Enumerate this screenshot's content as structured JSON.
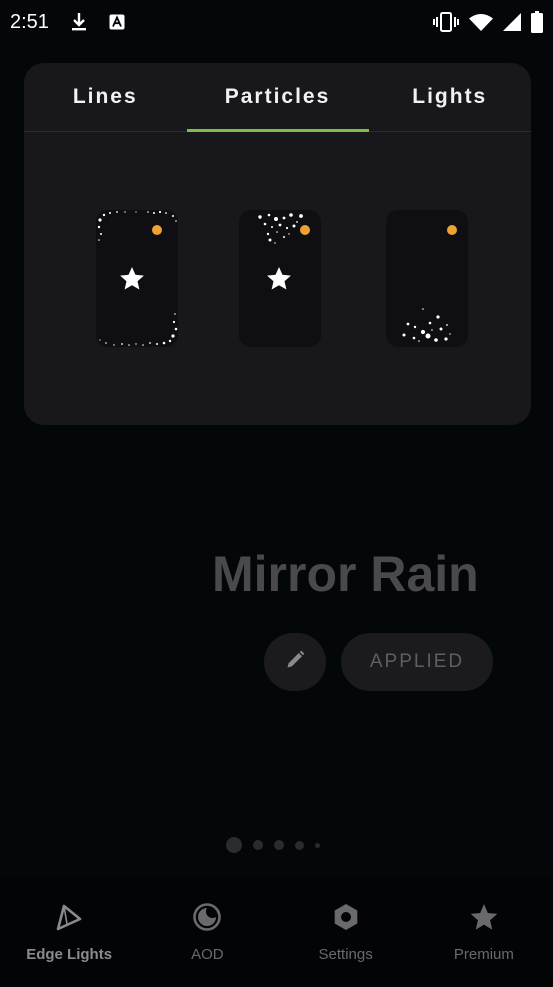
{
  "status_bar": {
    "time": "2:51",
    "icons": [
      "download-icon",
      "font-icon",
      "vibrate-icon",
      "wifi-icon",
      "signal-icon",
      "battery-icon"
    ]
  },
  "tabs": [
    {
      "label": "Lines",
      "active": false
    },
    {
      "label": "Particles",
      "active": true
    },
    {
      "label": "Lights",
      "active": false
    }
  ],
  "previews": [
    {
      "name": "particle-style-1",
      "icon": "star-icon",
      "badge_color": "#f0a22e"
    },
    {
      "name": "particle-style-2",
      "icon": "star-icon",
      "badge_color": "#f0a22e"
    },
    {
      "name": "particle-style-3",
      "icon": null,
      "badge_color": "#f0a22e"
    }
  ],
  "theme": {
    "title": "Mirror Rain",
    "applied_label": "APPLIED",
    "edit_icon": "pencil-icon"
  },
  "pagination": {
    "pages": 5,
    "current": 1
  },
  "bottom_nav": {
    "items": [
      {
        "label": "Edge Lights",
        "icon": "edge-lights-icon",
        "active": true
      },
      {
        "label": "AOD",
        "icon": "aod-icon",
        "active": false
      },
      {
        "label": "Settings",
        "icon": "settings-icon",
        "active": false
      },
      {
        "label": "Premium",
        "icon": "premium-star-icon",
        "active": false
      }
    ]
  },
  "colors": {
    "accent": "#7dc142",
    "badge": "#f0a22e",
    "background": "#04070a",
    "panel": "#18181c"
  }
}
